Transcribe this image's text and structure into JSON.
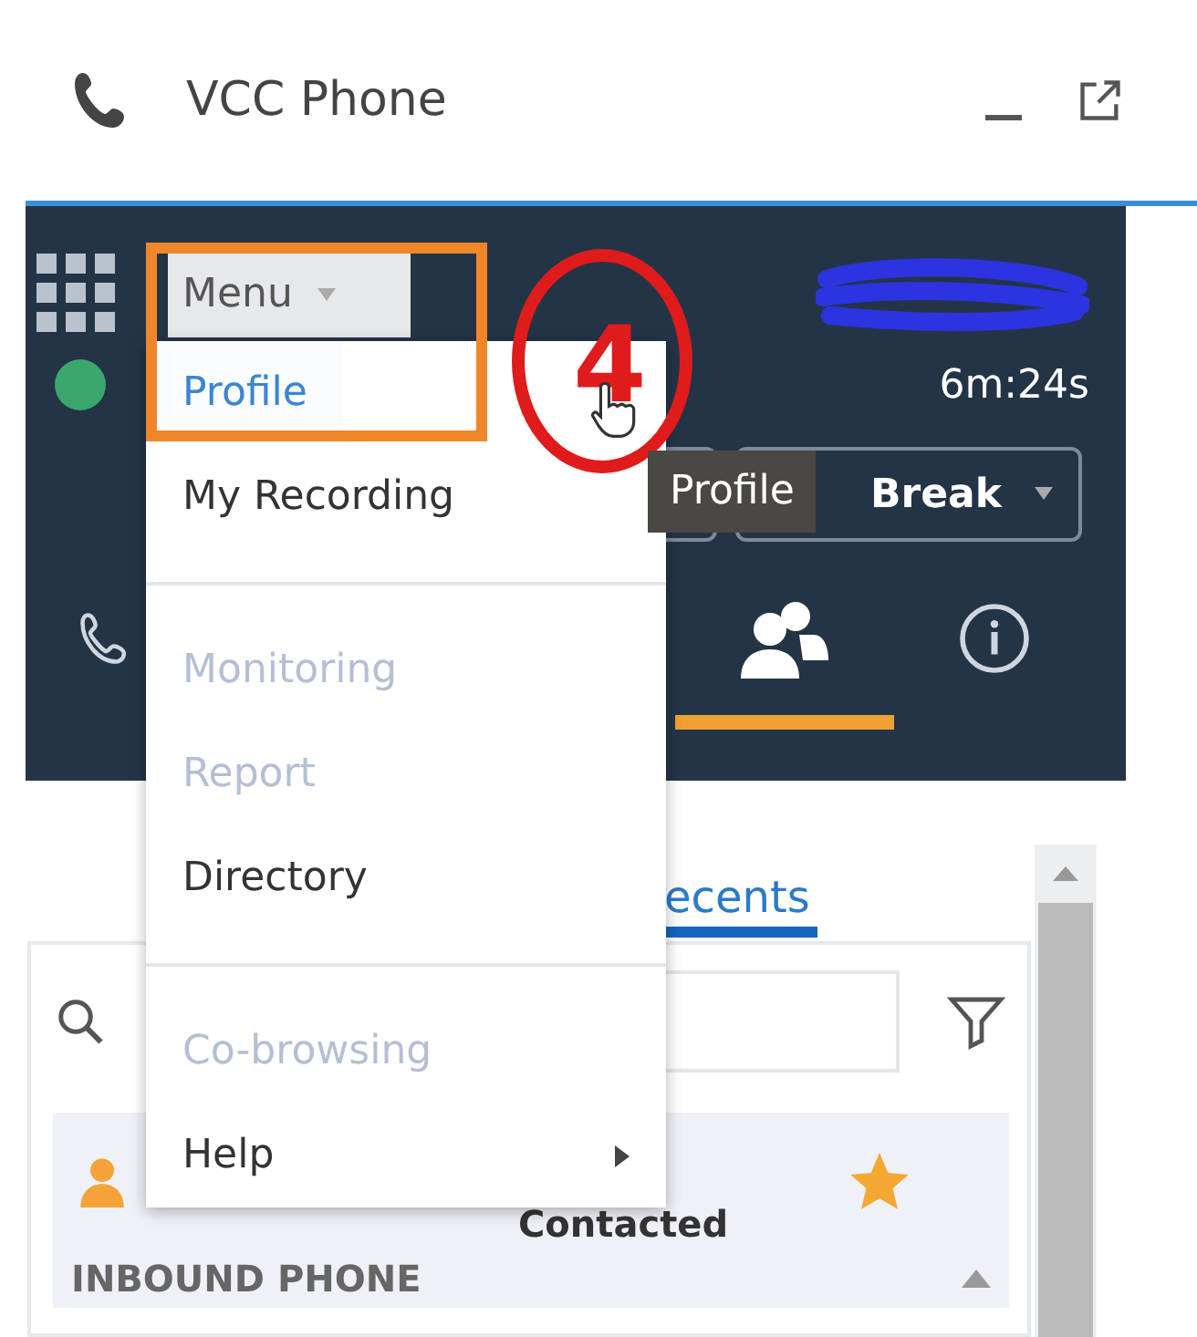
{
  "window": {
    "title": "VCC Phone"
  },
  "agent_bar": {
    "menu_button": "Menu",
    "timer": "6m:24s",
    "status_online": true,
    "break_button": "Break"
  },
  "tabs": [
    {
      "kind": "phone",
      "selected": false
    },
    {
      "kind": "contacts",
      "selected": true
    },
    {
      "kind": "info",
      "selected": false
    }
  ],
  "sub_tab": {
    "label": "ecents",
    "selected": true
  },
  "contact_row": {
    "status": "Contacted",
    "favorite": true
  },
  "section": {
    "title": "INBOUND PHONE"
  },
  "menu": [
    {
      "kind": "item",
      "label": "Profile",
      "selected": true,
      "disabled": false
    },
    {
      "kind": "item",
      "label": "My Recording",
      "selected": false,
      "disabled": false
    },
    {
      "kind": "divider"
    },
    {
      "kind": "item",
      "label": "Monitoring",
      "selected": false,
      "disabled": true
    },
    {
      "kind": "item",
      "label": "Report",
      "selected": false,
      "disabled": true
    },
    {
      "kind": "item",
      "label": "Directory",
      "selected": false,
      "disabled": false
    },
    {
      "kind": "divider"
    },
    {
      "kind": "item",
      "label": "Co-browsing",
      "selected": false,
      "disabled": true
    },
    {
      "kind": "submenu",
      "label": "Help",
      "selected": false,
      "disabled": false
    }
  ],
  "tooltip": "Profile",
  "annotation": {
    "step": "4"
  }
}
